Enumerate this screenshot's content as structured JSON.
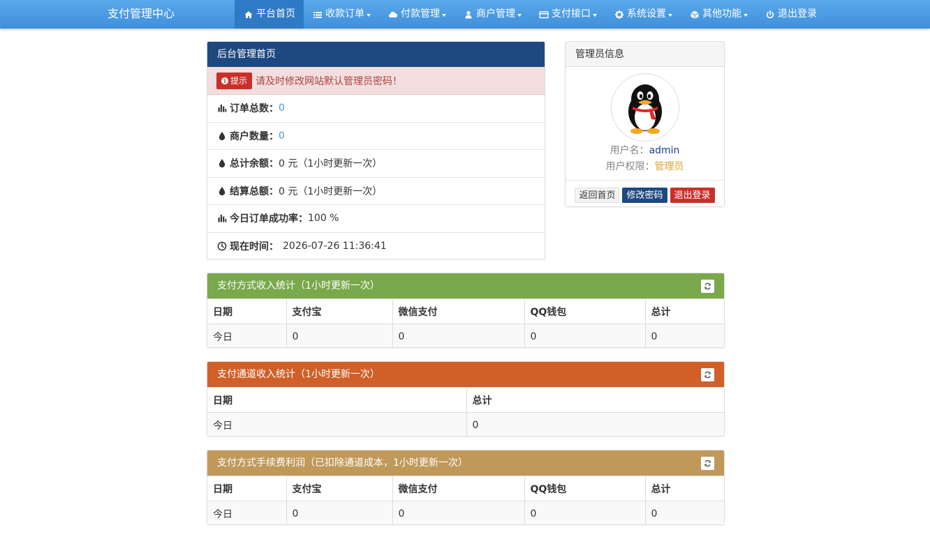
{
  "navbar": {
    "brand": "支付管理中心",
    "items": [
      {
        "label": "平台首页",
        "icon": "home-icon",
        "caret": false,
        "active": true
      },
      {
        "label": "收款订单",
        "icon": "list-icon",
        "caret": true
      },
      {
        "label": "付款管理",
        "icon": "cloud-icon",
        "caret": true
      },
      {
        "label": "商户管理",
        "icon": "user-icon",
        "caret": true
      },
      {
        "label": "支付接口",
        "icon": "card-icon",
        "caret": true
      },
      {
        "label": "系统设置",
        "icon": "gear-icon",
        "caret": true
      },
      {
        "label": "其他功能",
        "icon": "cube-icon",
        "caret": true
      },
      {
        "label": "退出登录",
        "icon": "power-icon",
        "caret": false
      }
    ]
  },
  "main_panel": {
    "title": "后台管理首页",
    "alert_badge": "提示",
    "alert_text": "请及时修改网站默认管理员密码！",
    "rows": [
      {
        "icon": "bar-chart-icon",
        "label": "订单总数：",
        "value": "0"
      },
      {
        "icon": "droplet-icon",
        "label": "商户数量：",
        "value": "0"
      },
      {
        "icon": "droplet-icon",
        "label": "总计余额：",
        "value": "0 元（1小时更新一次）"
      },
      {
        "icon": "droplet-icon",
        "label": "结算总额：",
        "value": "0 元（1小时更新一次）"
      },
      {
        "icon": "bar-chart-icon",
        "label": "今日订单成功率：",
        "value": "100 %"
      },
      {
        "icon": "clock-icon",
        "label": "现在时间：",
        "value": "2026-07-26 11:36:41"
      }
    ]
  },
  "admin_panel": {
    "title": "管理员信息",
    "username_label": "用户名：",
    "username": "admin",
    "role_label": "用户权限：",
    "role": "管理员",
    "btn_home": "返回首页",
    "btn_password": "修改密码",
    "btn_logout": "退出登录"
  },
  "stats_method": {
    "title": "支付方式收入统计（1小时更新一次）",
    "headers": [
      "日期",
      "支付宝",
      "微信支付",
      "QQ钱包",
      "总计"
    ],
    "row": [
      "今日",
      "0",
      "0",
      "0",
      "0"
    ]
  },
  "stats_channel": {
    "title": "支付通道收入统计（1小时更新一次）",
    "headers": [
      "日期",
      "总计"
    ],
    "row": [
      "今日",
      "0"
    ]
  },
  "stats_profit": {
    "title": "支付方式手续费利润（已扣除通道成本，1小时更新一次）",
    "headers": [
      "日期",
      "支付宝",
      "微信支付",
      "QQ钱包",
      "总计"
    ],
    "row": [
      "今日",
      "0",
      "0",
      "0",
      "0"
    ]
  }
}
